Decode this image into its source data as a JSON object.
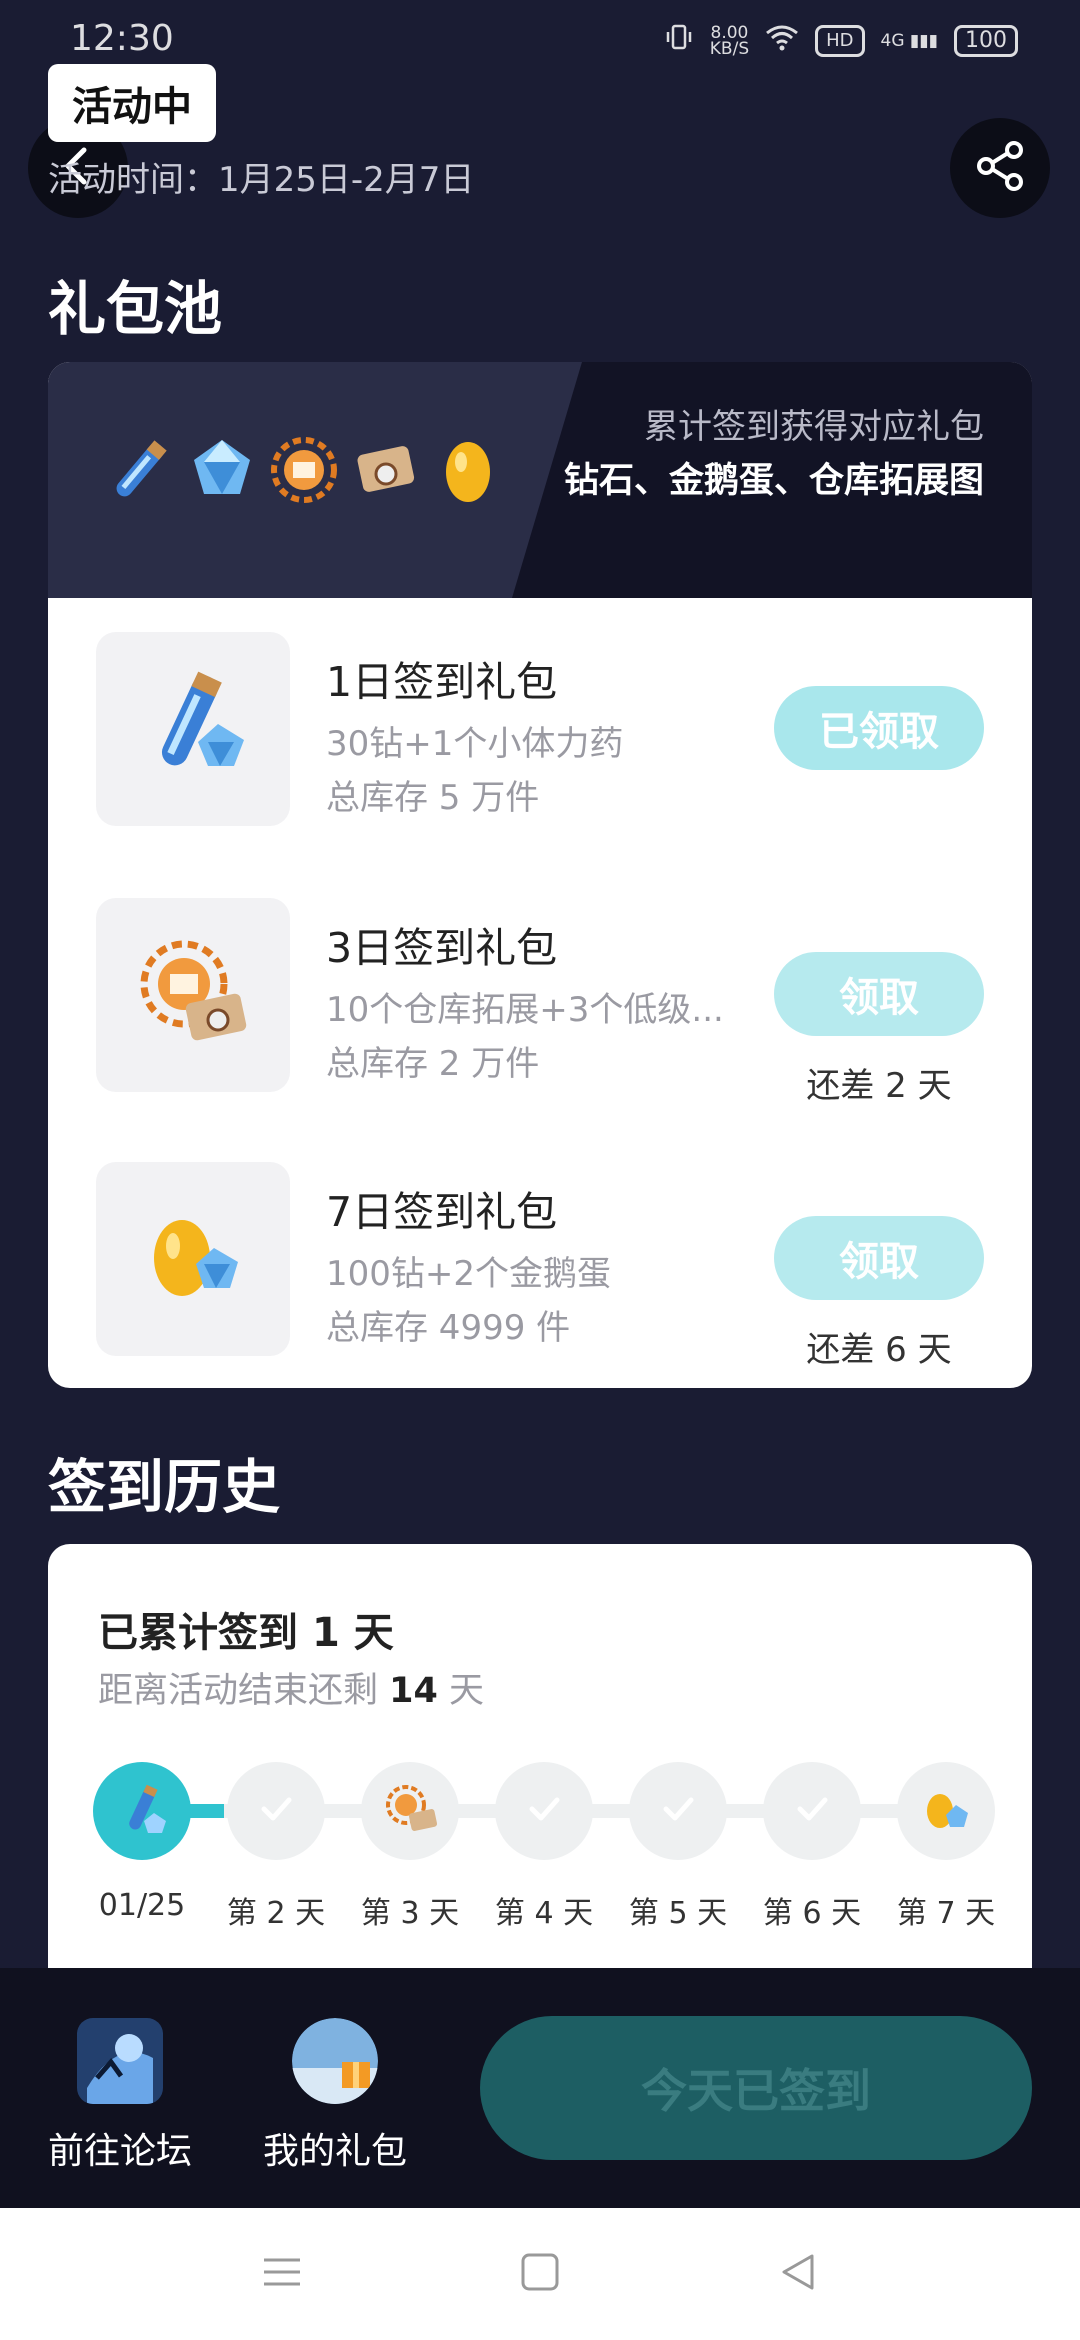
{
  "status_bar": {
    "time": "12:30",
    "net_speed_value": "8.00",
    "net_speed_unit": "KB/S",
    "hd_label": "HD",
    "signal_label": "4G",
    "battery": "100"
  },
  "header": {
    "badge": "活动中",
    "period_label": "活动时间：1月25日-2月7日"
  },
  "gift_pool": {
    "title": "礼包池",
    "banner_sub": "累计签到获得对应礼包",
    "banner_main": "钻石、金鹅蛋、仓库拓展图",
    "items": [
      {
        "title": "1日签到礼包",
        "desc": "30钻+1个小体力药",
        "stock": "总库存 5 万件",
        "button": "已领取",
        "remain": ""
      },
      {
        "title": "3日签到礼包",
        "desc": "10个仓库拓展+3个低级...",
        "stock": "总库存 2 万件",
        "button": "领取",
        "remain": "还差 2 天"
      },
      {
        "title": "7日签到礼包",
        "desc": "100钻+2个金鹅蛋",
        "stock": "总库存 4999 件",
        "button": "领取",
        "remain": "还差 6 天"
      }
    ]
  },
  "history": {
    "title": "签到历史",
    "total_prefix": "已累计签到 ",
    "total_days": "1",
    "total_suffix": " 天",
    "remain_prefix": "距离活动结束还剩 ",
    "remain_days": "14",
    "remain_suffix": " 天",
    "days": [
      "01/25",
      "第 2 天",
      "第 3 天",
      "第 4 天",
      "第 5 天",
      "第 6 天",
      "第 7 天"
    ],
    "progress_fraction": 0.14
  },
  "bottom_bar": {
    "forum_label": "前往论坛",
    "gifts_label": "我的礼包",
    "signed_label": "今天已签到"
  },
  "colors": {
    "background": "#1a1c33",
    "accent": "#2fc3cf",
    "claim_button": "#a9e7ec",
    "signed_button": "#1d5e63"
  }
}
